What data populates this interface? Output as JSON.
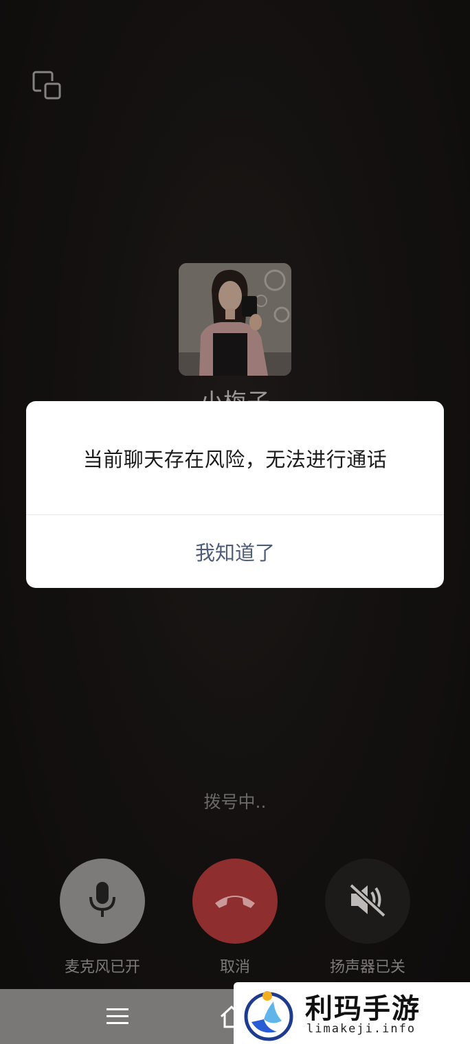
{
  "contact": {
    "name": "小梅子"
  },
  "dialog": {
    "message": "当前聊天存在风险，无法进行通话",
    "confirm_label": "我知道了"
  },
  "call": {
    "status": "拨号中.."
  },
  "controls": {
    "mic_label": "麦克风已开",
    "hangup_label": "取消",
    "speaker_label": "扬声器已关"
  },
  "watermark": {
    "title": "利玛手游",
    "url": "limakeji.info"
  },
  "colors": {
    "hangup": "#8e2e2f",
    "mic_bg": "#7d7b79",
    "dialog_button": "#4e5d7a"
  }
}
